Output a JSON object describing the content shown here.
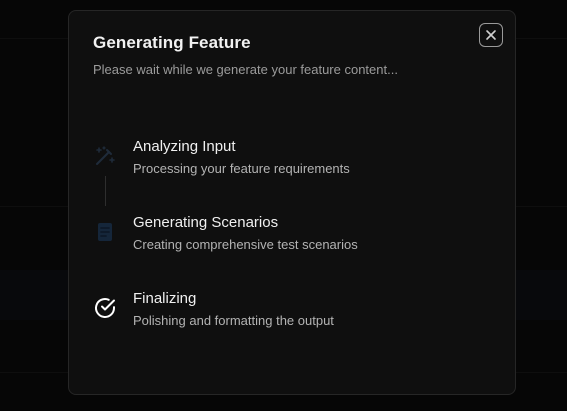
{
  "dialog": {
    "title": "Generating Feature",
    "subtitle": "Please wait while we generate your feature content...",
    "close_icon": "close-icon"
  },
  "steps": [
    {
      "icon": "magic-wand-icon",
      "title": "Analyzing Input",
      "description": "Processing your feature requirements",
      "status": "pending"
    },
    {
      "icon": "document-icon",
      "title": "Generating Scenarios",
      "description": "Creating comprehensive test scenarios",
      "status": "pending"
    },
    {
      "icon": "check-circle-icon",
      "title": "Finalizing",
      "description": "Polishing and formatting the output",
      "status": "complete"
    }
  ],
  "colors": {
    "modal_background": "#0f0f0f",
    "border": "#262626",
    "title": "#f2f2f2",
    "muted_text": "#9b9b9b",
    "pending_icon": "#1b2a3c",
    "complete_icon": "#ffffff"
  }
}
